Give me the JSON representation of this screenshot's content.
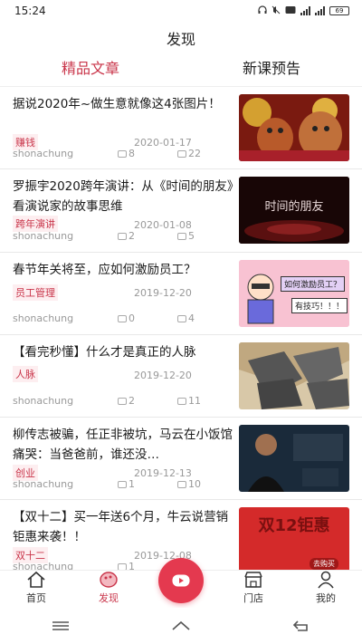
{
  "status_bar": {
    "time": "15:24",
    "battery": "69"
  },
  "header": {
    "title": "发现"
  },
  "tabs": [
    {
      "label": "精品文章"
    },
    {
      "label": "新课预告"
    }
  ],
  "articles": [
    {
      "title": "据说2020年~做生意就像这4张图片！",
      "tag": "赚钱",
      "date": "2020-01-17",
      "author": "shonachung",
      "comments": "8",
      "likes": "22",
      "thumb_text": ""
    },
    {
      "title": "罗振宇2020跨年演讲：从《时间的朋友》看演说家的故事思维",
      "tag": "跨年演讲",
      "date": "2020-01-08",
      "author": "shonachung",
      "comments": "2",
      "likes": "5",
      "thumb_text": "时间的朋友"
    },
    {
      "title": "春节年关将至，应如何激励员工？",
      "tag": "员工管理",
      "date": "2019-12-20",
      "author": "shonachung",
      "comments": "0",
      "likes": "4",
      "thumb_text": "如何激励员工？",
      "thumb_text2": "有技巧！！！"
    },
    {
      "title": "【看完秒懂】什么才是真正的人脉",
      "tag": "人脉",
      "date": "2019-12-20",
      "author": "shonachung",
      "comments": "2",
      "likes": "11",
      "thumb_text": ""
    },
    {
      "title": "柳传志被骗，任正非被坑，马云在小饭馆痛哭：当爸爸前，谁还没…",
      "tag": "创业",
      "date": "2019-12-13",
      "author": "shonachung",
      "comments": "1",
      "likes": "10",
      "thumb_text": ""
    },
    {
      "title": "【双十二】买一年送6个月，牛云说营销钜惠来袭！！",
      "tag": "双十二",
      "date": "2019-12-08",
      "author": "shonachung",
      "comments": "1",
      "likes": "",
      "thumb_text": "双12钜惠",
      "thumb_text2": "去购买"
    }
  ],
  "bottom_nav": [
    {
      "label": "首页"
    },
    {
      "label": "发现"
    },
    {
      "label": "门店"
    },
    {
      "label": "我的"
    }
  ],
  "colors": {
    "accent": "#c9354a",
    "play": "#e4394f"
  }
}
